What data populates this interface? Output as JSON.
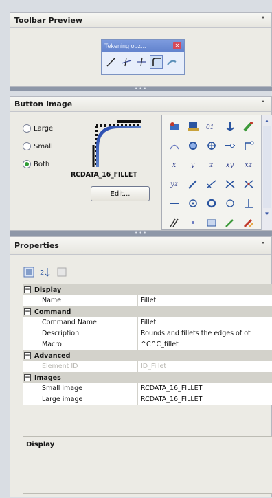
{
  "toolbar_preview": {
    "title": "Toolbar Preview",
    "mini_toolbar_title": "Tekening opz..."
  },
  "button_image": {
    "title": "Button Image",
    "radios": [
      {
        "label": "Large",
        "selected": false
      },
      {
        "label": "Small",
        "selected": false
      },
      {
        "label": "Both",
        "selected": true
      }
    ],
    "image_name": "RCDATA_16_FILLET",
    "edit_label": "Edit...",
    "grid_labels": [
      "x",
      "y",
      "z",
      "xy",
      "xz",
      "yz"
    ]
  },
  "properties": {
    "title": "Properties",
    "categories": [
      {
        "name": "Display",
        "rows": [
          {
            "key": "Name",
            "value": "Fillet"
          }
        ]
      },
      {
        "name": "Command",
        "rows": [
          {
            "key": "Command Name",
            "value": "Fillet"
          },
          {
            "key": "Description",
            "value": "Rounds and fillets the edges of ot"
          },
          {
            "key": "Macro",
            "value": "^C^C_fillet"
          }
        ]
      },
      {
        "name": "Advanced",
        "rows": [
          {
            "key": "Element ID",
            "value": "ID_Fillet",
            "disabled": true
          }
        ]
      },
      {
        "name": "Images",
        "rows": [
          {
            "key": "Small image",
            "value": "RCDATA_16_FILLET"
          },
          {
            "key": "Large image",
            "value": "RCDATA_16_FILLET"
          }
        ]
      }
    ],
    "description_title": "Display"
  },
  "colors": {
    "accent": "#6384ce",
    "selected_radio": "#2f9c37",
    "splitter": "#8e97a8"
  }
}
